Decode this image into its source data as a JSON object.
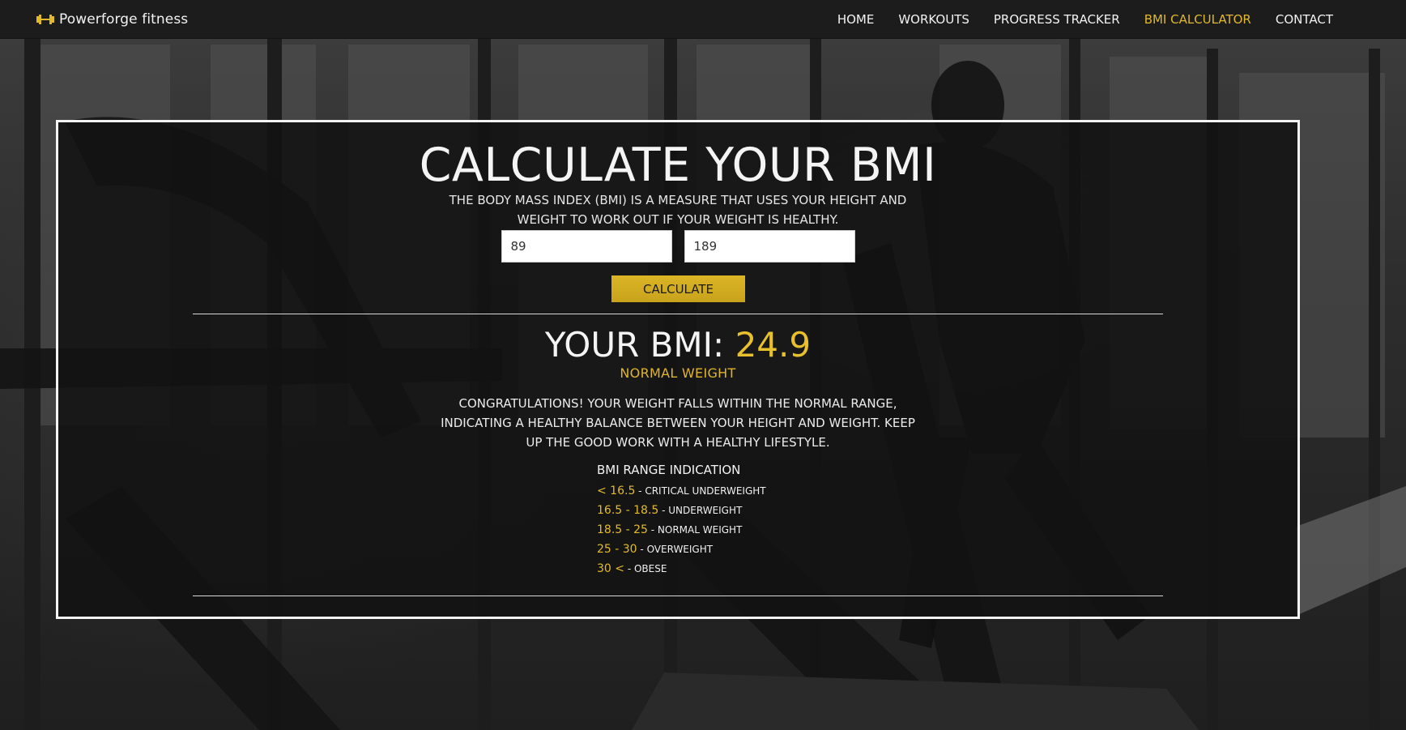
{
  "navbar": {
    "brand": "Powerforge fitness",
    "brand_icon": "dumbbell-icon",
    "items": [
      {
        "label": "HOME",
        "active": false
      },
      {
        "label": "WORKOUTS",
        "active": false
      },
      {
        "label": "PROGRESS TRACKER",
        "active": false
      },
      {
        "label": "BMI CALCULATOR",
        "active": true
      },
      {
        "label": "CONTACT",
        "active": false
      }
    ]
  },
  "calculator": {
    "title": "CALCULATE YOUR BMI",
    "subtitle": "THE BODY MASS INDEX (BMI) IS A MEASURE THAT USES YOUR HEIGHT AND WEIGHT TO WORK OUT IF YOUR WEIGHT IS HEALTHY.",
    "weight_value": "89",
    "height_value": "189",
    "calculate_label": "CALCULATE"
  },
  "result": {
    "prefix": "YOUR BMI: ",
    "value": "24.9",
    "category": "NORMAL WEIGHT",
    "message": "CONGRATULATIONS! YOUR WEIGHT FALLS WITHIN THE NORMAL RANGE, INDICATING A HEALTHY BALANCE BETWEEN YOUR HEIGHT AND WEIGHT. KEEP UP THE GOOD WORK WITH A HEALTHY LIFESTYLE."
  },
  "ranges": {
    "heading": "BMI RANGE INDICATION",
    "separator": " - ",
    "items": [
      {
        "range": "< 16.5",
        "label": "CRITICAL UNDERWEIGHT"
      },
      {
        "range": "16.5 - 18.5",
        "label": "UNDERWEIGHT"
      },
      {
        "range": "18.5 - 25",
        "label": "NORMAL WEIGHT"
      },
      {
        "range": "25 - 30",
        "label": "OVERWEIGHT"
      },
      {
        "range": "30 <",
        "label": "OBESE"
      }
    ]
  },
  "colors": {
    "accent": "#e0b92b",
    "navbar_bg": "#1c1c1c",
    "card_border": "#f4f4f4"
  }
}
